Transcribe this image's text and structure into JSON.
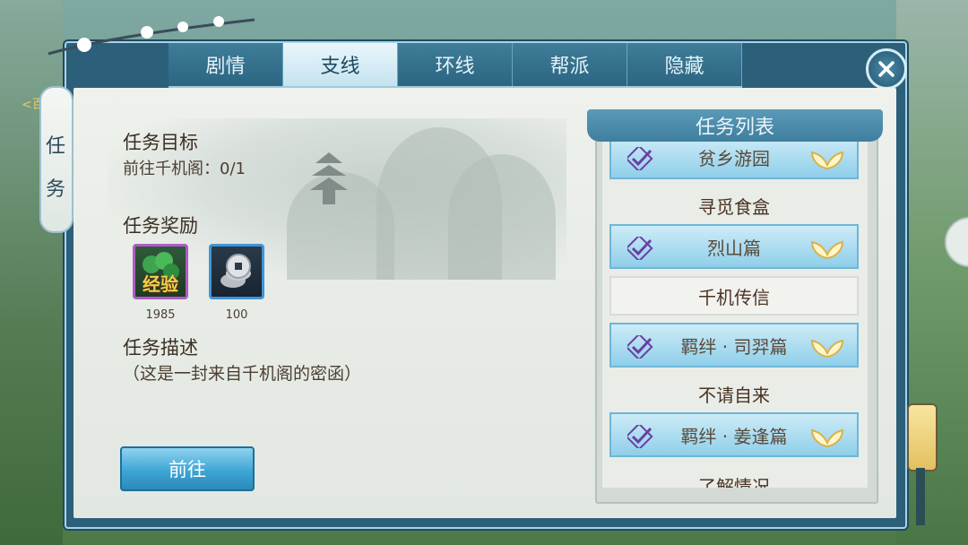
{
  "tabs": [
    {
      "label": "剧情",
      "active": false
    },
    {
      "label": "支线",
      "active": true
    },
    {
      "label": "环线",
      "active": false
    },
    {
      "label": "帮派",
      "active": false
    },
    {
      "label": "隐藏",
      "active": false
    }
  ],
  "side_tab": {
    "label": "任务",
    "edge_label": "<百"
  },
  "quest": {
    "objective_title": "任务目标",
    "objective_text": "前往千机阁：0/1",
    "reward_title": "任务奖励",
    "rewards": [
      {
        "name": "经验",
        "icon": "experience-icon",
        "amount": "1985"
      },
      {
        "name": "",
        "icon": "coins-icon",
        "amount": "100"
      }
    ],
    "desc_title": "任务描述",
    "desc_text": "（这是一封来自千机阁的密函）",
    "go_button": "前往"
  },
  "task_list": {
    "title": "任务列表",
    "items": [
      {
        "label": "贫乡游园",
        "type": "category",
        "icons": [
          "check-icon",
          "lotus-icon"
        ]
      },
      {
        "label": "寻觅食盒",
        "type": "sub"
      },
      {
        "label": "烈山篇",
        "type": "category",
        "icons": [
          "check-icon",
          "lotus-icon"
        ]
      },
      {
        "label": "千机传信",
        "type": "selected"
      },
      {
        "label": "羁绊 · 司羿篇",
        "type": "category",
        "icons": [
          "check-icon",
          "lotus-icon"
        ]
      },
      {
        "label": "不请自来",
        "type": "sub"
      },
      {
        "label": "羁绊 · 姜逢篇",
        "type": "category",
        "icons": [
          "check-icon",
          "lotus-icon"
        ]
      },
      {
        "label": "了解情况",
        "type": "sub"
      }
    ]
  },
  "colors": {
    "accent": "#3ea6d6",
    "frame": "#2c5f7a",
    "check": "#6a3fa3"
  }
}
